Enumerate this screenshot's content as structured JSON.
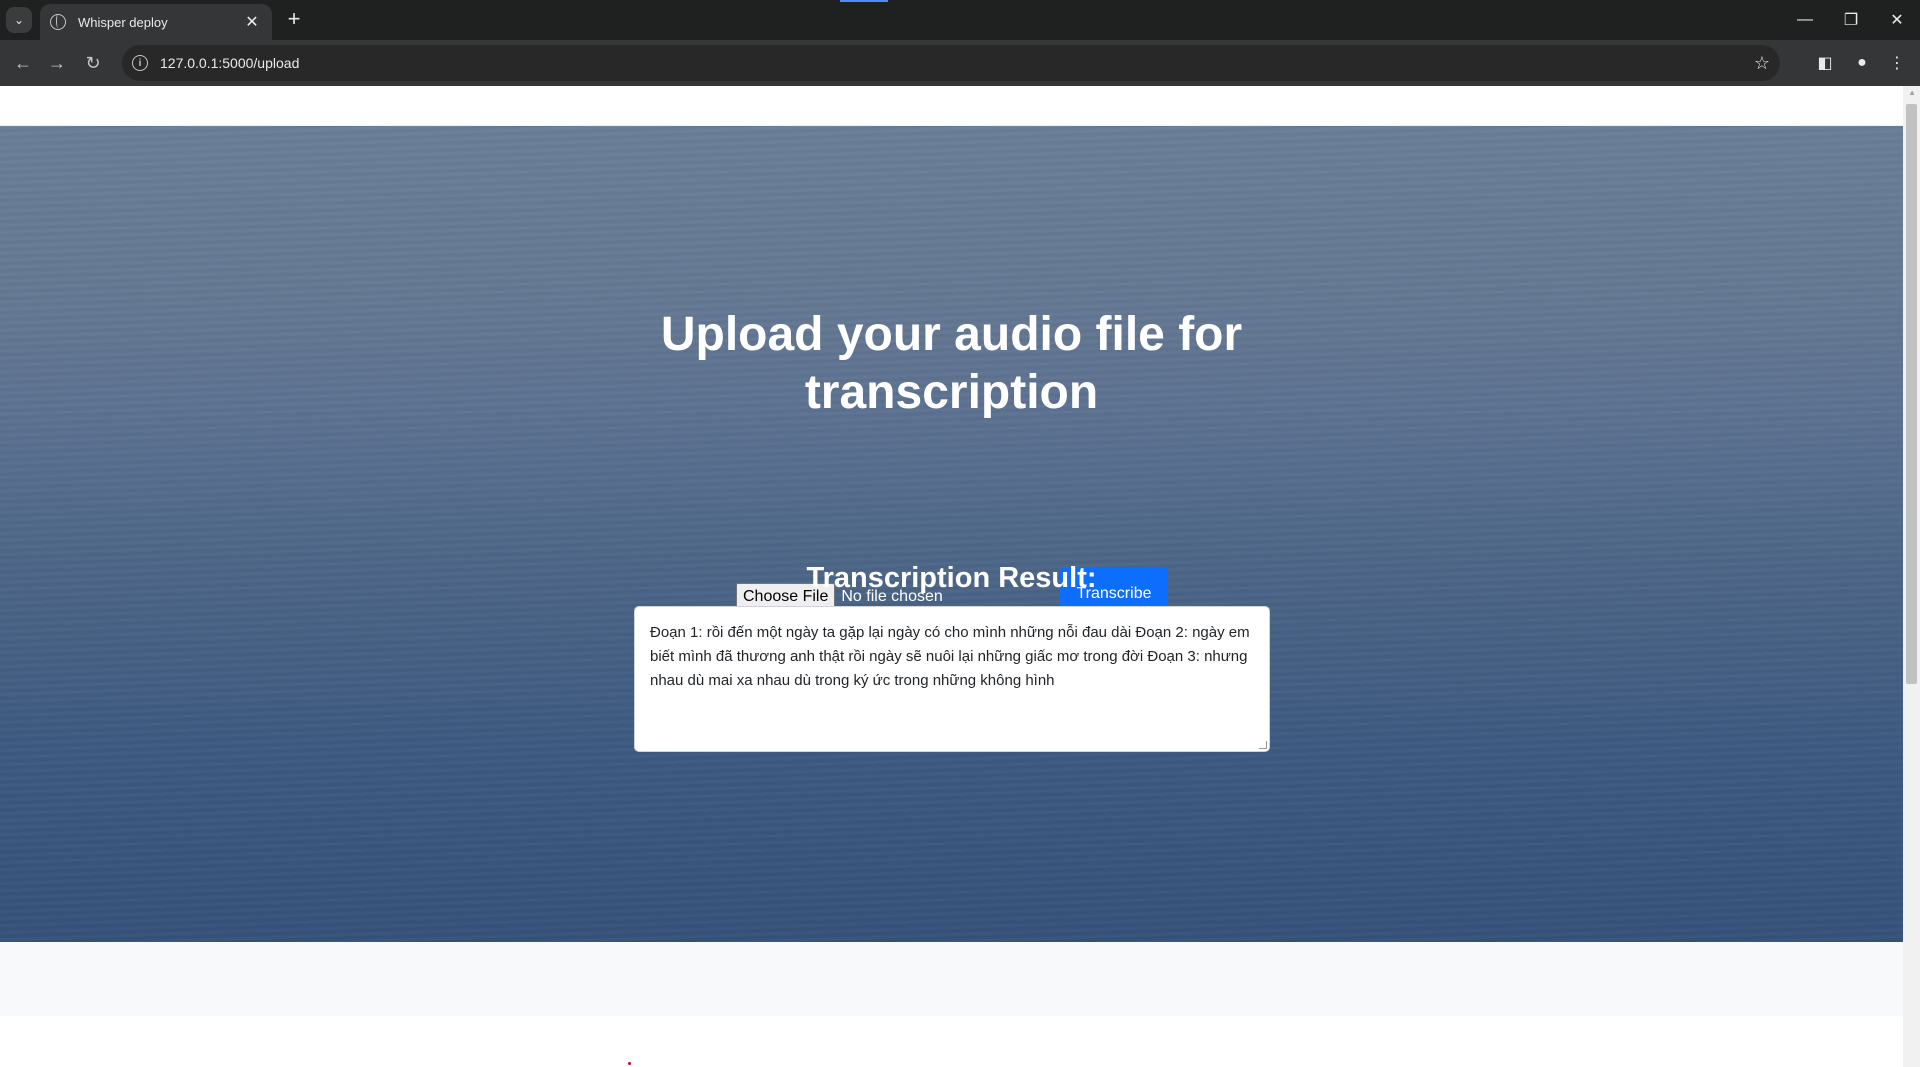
{
  "browser": {
    "tab_title": "Whisper deploy",
    "url": "127.0.0.1:5000/upload"
  },
  "page": {
    "hero_title_line1": "Upload your audio file for",
    "hero_title_line2": "transcription",
    "choose_file_label": "Choose File",
    "file_status": "No file chosen",
    "transcribe_label": "Transcribe",
    "result_heading": "Transcription Result:",
    "result_text": " Đoạn 1: rồi đến một ngày ta gặp lại ngày có cho mình những nỗi đau dài  Đoạn 2: ngày em biết mình đã thương anh thật rồi ngày sẽ nuôi lại những giấc mơ trong đời  Đoạn 3: nhưng nhau dù mai xa nhau dù trong ký ức trong những không hình"
  },
  "colors": {
    "primary_button": "#0d6efd",
    "hero_top": "#6a7e99",
    "hero_bottom": "#36527a"
  }
}
